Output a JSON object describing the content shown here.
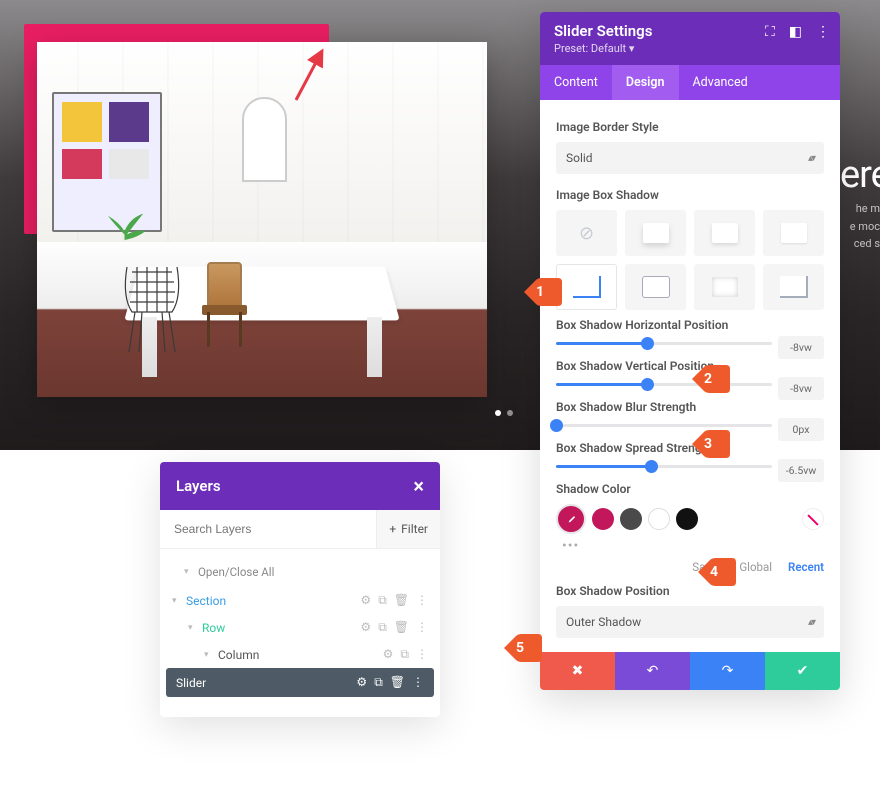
{
  "backdrop": {
    "headline_fragment": "ere",
    "sub1": "he m",
    "sub2": "e moc",
    "sub3": "ced s"
  },
  "layers": {
    "title": "Layers",
    "search_placeholder": "Search Layers",
    "filter_label": "Filter",
    "open_close": "Open/Close All",
    "section": "Section",
    "row": "Row",
    "column": "Column",
    "slider": "Slider"
  },
  "panel": {
    "title": "Slider Settings",
    "preset": "Preset: Default",
    "tab_content": "Content",
    "tab_design": "Design",
    "tab_advanced": "Advanced",
    "border_style_label": "Image Border Style",
    "border_style_value": "Solid",
    "box_shadow_label": "Image Box Shadow",
    "h_pos_label": "Box Shadow Horizontal Position",
    "h_pos_value": "-8vw",
    "v_pos_label": "Box Shadow Vertical Position",
    "v_pos_value": "-8vw",
    "blur_label": "Box Shadow Blur Strength",
    "blur_value": "0px",
    "spread_label": "Box Shadow Spread Strength",
    "spread_value": "-6.5vw",
    "shadow_color_label": "Shadow Color",
    "color_tab_saved": "Saved",
    "color_tab_global": "Global",
    "color_tab_recent": "Recent",
    "shadow_pos_label": "Box Shadow Position",
    "shadow_pos_value": "Outer Shadow"
  },
  "callouts": {
    "c1": "1",
    "c2": "2",
    "c3": "3",
    "c4": "4",
    "c5": "5"
  }
}
